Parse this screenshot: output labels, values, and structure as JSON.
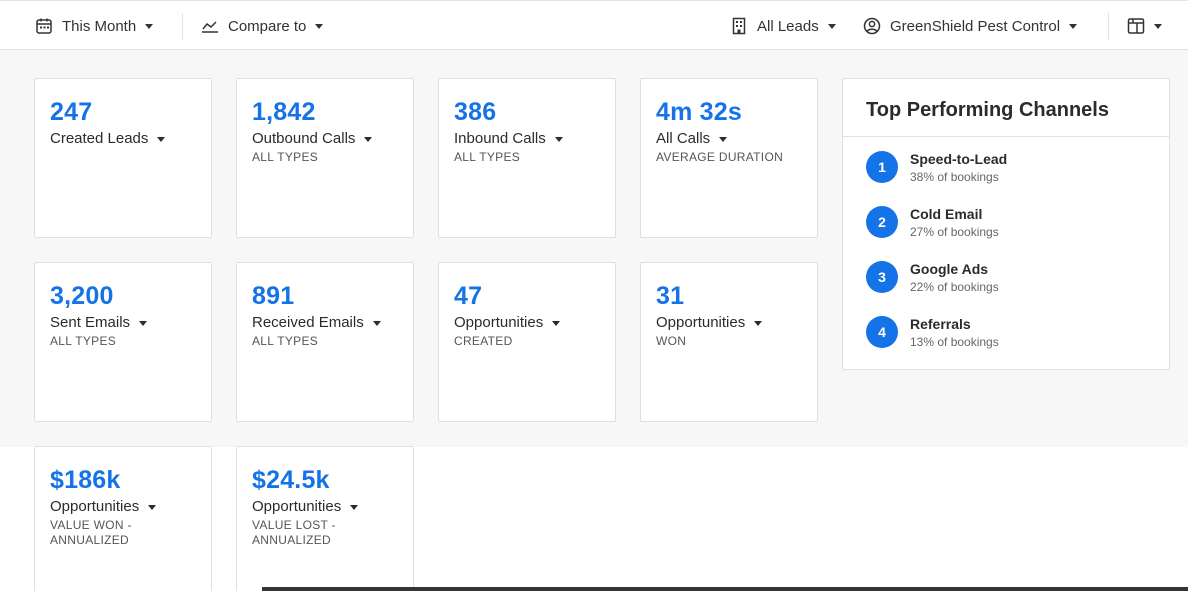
{
  "topbar": {
    "period": "This Month",
    "compare": "Compare to",
    "leads_filter": "All Leads",
    "account": "GreenShield Pest Control"
  },
  "metrics": [
    {
      "value": "247",
      "label": "Created Leads",
      "sub": ""
    },
    {
      "value": "1,842",
      "label": "Outbound Calls",
      "sub": "ALL TYPES"
    },
    {
      "value": "386",
      "label": "Inbound Calls",
      "sub": "ALL TYPES"
    },
    {
      "value": "4m 32s",
      "label": "All Calls",
      "sub": "AVERAGE DURATION"
    },
    {
      "value": "3,200",
      "label": "Sent Emails",
      "sub": "ALL TYPES"
    },
    {
      "value": "891",
      "label": "Received Emails",
      "sub": "ALL TYPES"
    },
    {
      "value": "47",
      "label": "Opportunities",
      "sub": "CREATED"
    },
    {
      "value": "31",
      "label": "Opportunities",
      "sub": "WON"
    },
    {
      "value": "$186k",
      "label": "Opportunities",
      "sub": "VALUE WON - ANNUALIZED"
    },
    {
      "value": "$24.5k",
      "label": "Opportunities",
      "sub": "VALUE LOST - ANNUALIZED"
    }
  ],
  "channels": {
    "title": "Top Performing Channels",
    "items": [
      {
        "rank": "1",
        "name": "Speed-to-Lead",
        "pct": "38% of bookings"
      },
      {
        "rank": "2",
        "name": "Cold Email",
        "pct": "27% of bookings"
      },
      {
        "rank": "3",
        "name": "Google Ads",
        "pct": "22% of bookings"
      },
      {
        "rank": "4",
        "name": "Referrals",
        "pct": "13% of bookings"
      }
    ]
  },
  "colors": {
    "accent": "#1473e6",
    "background": "#f7f7f7",
    "card": "#ffffff"
  }
}
